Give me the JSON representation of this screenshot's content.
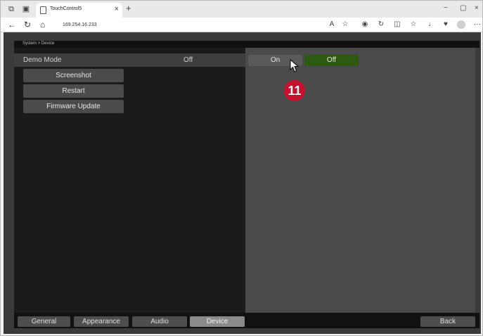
{
  "browser": {
    "tab_title": "TouchControl5",
    "url": "169.254.16.233",
    "tab_close_glyph": "×",
    "new_tab_glyph": "+",
    "window_controls": [
      "−",
      "▢",
      "×"
    ],
    "more_glyph": "···"
  },
  "app": {
    "breadcrumb": "System > Device",
    "demo_mode": {
      "label": "Demo Mode",
      "value": "Off"
    },
    "actions": [
      "Screenshot",
      "Restart",
      "Firmware Update"
    ],
    "toggle": {
      "on_label": "On",
      "off_label": "Off",
      "selected": "Off"
    },
    "callout_number": "11",
    "nav_tabs": [
      "General",
      "Appearance",
      "Audio",
      "Device"
    ],
    "active_tab": "Device",
    "back_label": "Back"
  },
  "colors": {
    "accent_green": "#2c5a12",
    "callout_red": "#c8102e",
    "panel_dark": "#1b1b1b",
    "panel_right": "#4a4a4a"
  }
}
